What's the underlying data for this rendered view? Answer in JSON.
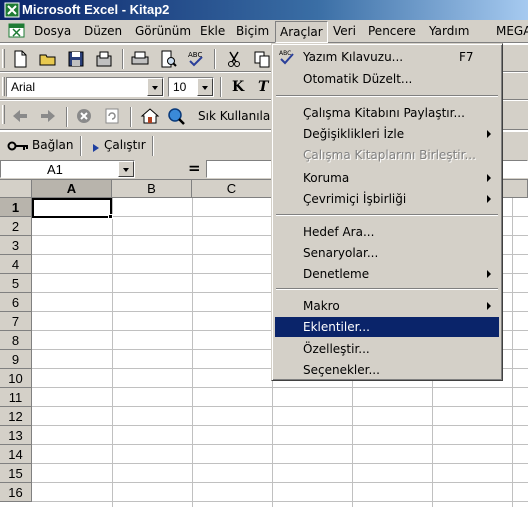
{
  "window": {
    "title": "Microsoft Excel - Kitap2",
    "app_icon": "excel-icon"
  },
  "menubar": {
    "items": [
      "Dosya",
      "Düzen",
      "Görünüm",
      "Ekle",
      "Biçim",
      "Araçlar",
      "Veri",
      "Pencere",
      "Yardım",
      "MEGA"
    ],
    "active": "Araçlar"
  },
  "format_toolbar": {
    "font": "Arial",
    "size": "10",
    "bold_label": "K",
    "italic_label": "T"
  },
  "web_toolbar": {
    "favorites_label": "Sık Kullanılar"
  },
  "custom_toolbar": {
    "connect_label": "Bağlan",
    "run_label": "Çalıştır"
  },
  "formula_bar": {
    "cell_ref": "A1",
    "equals": "=",
    "value": ""
  },
  "sheet": {
    "columns": [
      "A",
      "B",
      "C"
    ],
    "rows": [
      "1",
      "2",
      "3",
      "4",
      "5",
      "6",
      "7",
      "8",
      "9",
      "10",
      "11",
      "12",
      "13",
      "14",
      "15",
      "16"
    ],
    "active_cell": "A1"
  },
  "tools_menu": {
    "spelling": {
      "label": "Yazım Kılavuzu...",
      "shortcut": "F7",
      "icon": "spellcheck-icon"
    },
    "autocorrect": "Otomatik Düzelt...",
    "share_workbook": "Çalışma Kitabını Paylaştır...",
    "track_changes": "Değişiklikleri İzle",
    "merge_workbooks": "Çalışma Kitaplarını Birleştir...",
    "protection": "Koruma",
    "online_collab": "Çevrimiçi İşbirliği",
    "goal_seek": "Hedef Ara...",
    "scenarios": "Senaryolar...",
    "auditing": "Denetleme",
    "macro": "Makro",
    "addins": "Eklentiler...",
    "customize": "Özelleştir...",
    "options": "Seçenekler..."
  }
}
